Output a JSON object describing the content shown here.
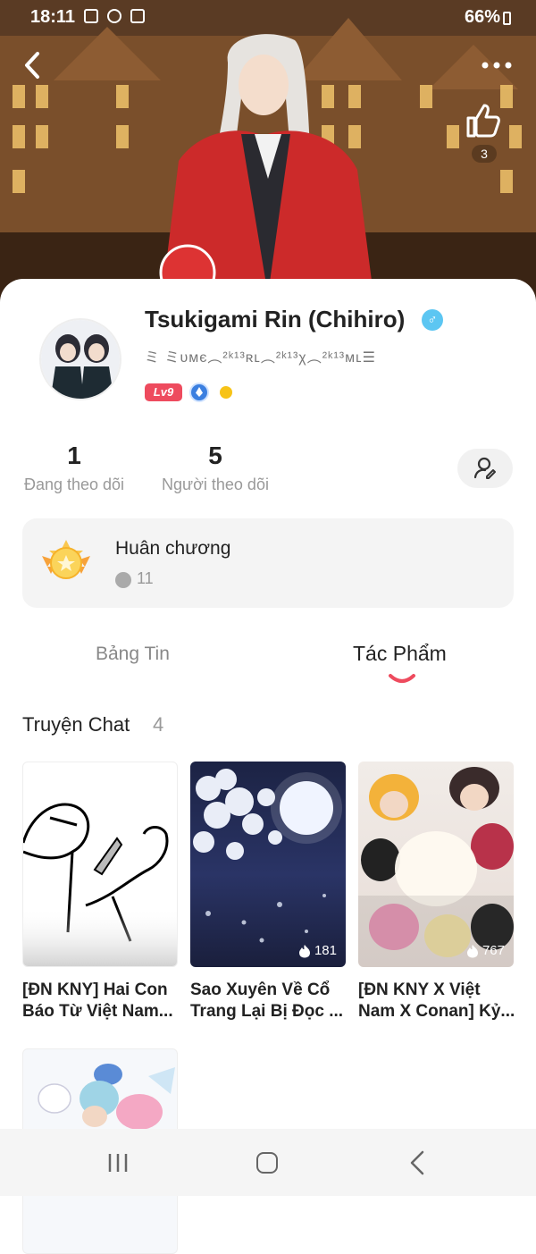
{
  "status": {
    "time": "18:11",
    "battery": "66%"
  },
  "header": {
    "like_count": "3",
    "icons": [
      "back-icon",
      "more-icon",
      "thumbs-up-icon"
    ]
  },
  "profile": {
    "name": "Tsukigami Rin (Chihiro)",
    "gender_symbol": "♂",
    "nickname": "ミ ミᴜᴍє︵²ᵏ¹³ʀʟ︵²ᵏ¹³χ︵²ᵏ¹³ᴍʟ☰",
    "level": "Lv9"
  },
  "stats": {
    "following_count": "1",
    "following_label": "Đang theo dõi",
    "followers_count": "5",
    "followers_label": "Người theo dõi"
  },
  "medals": {
    "title": "Huân chương",
    "count": "11"
  },
  "tabs": [
    {
      "label": "Bảng Tin",
      "active": false
    },
    {
      "label": "Tác Phẩm",
      "active": true
    }
  ],
  "section": {
    "title": "Truyện Chat",
    "count": "4"
  },
  "stories": [
    {
      "title_line1": "[ĐN KNY] Hai Con",
      "title_line2": "Báo Từ Việt Nam...",
      "views": ""
    },
    {
      "title_line1": "Sao Xuyên Về Cổ",
      "title_line2": "Trang Lại Bị Đọc ...",
      "views": "181"
    },
    {
      "title_line1": "[ĐN KNY X Việt",
      "title_line2": "Nam X Conan] Kỷ...",
      "views": "767"
    },
    {
      "title_line1": "",
      "title_line2": "",
      "views": ""
    }
  ],
  "colors": {
    "accent": "#ee4b5e",
    "level_badge": "#ee4b5e",
    "gender_badge": "#5cc6f2"
  }
}
